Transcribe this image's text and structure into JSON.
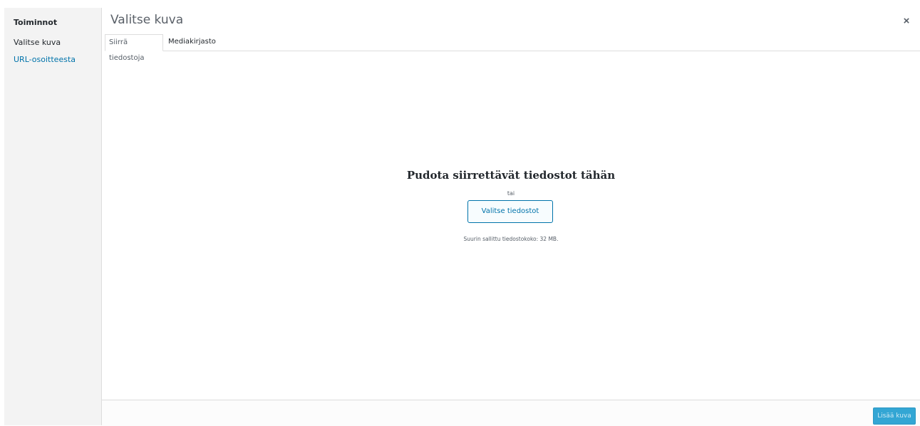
{
  "menu": {
    "heading": "Toiminnot",
    "items": [
      {
        "label": "Valitse kuva",
        "active": true
      },
      {
        "label": "URL-osoitteesta",
        "active": false
      }
    ]
  },
  "modal": {
    "title": "Valitse kuva",
    "close_icon": "close-icon",
    "close_glyph": "×"
  },
  "tabs": [
    {
      "label": "Siirrä tiedostoja",
      "active": true
    },
    {
      "label": "Mediakirjasto",
      "active": false
    }
  ],
  "uploader": {
    "title": "Pudota siirrettävät tiedostot tähän",
    "or_text": "tai",
    "select_button": "Valitse tiedostot",
    "max_size_text": "Suurin sallittu tiedostokoko: 32 MB."
  },
  "toolbar": {
    "insert_button": "Lisää kuva"
  },
  "colors": {
    "link": "#0073aa",
    "primary_button": "#33a6d4",
    "menu_bg": "#f3f3f3"
  }
}
